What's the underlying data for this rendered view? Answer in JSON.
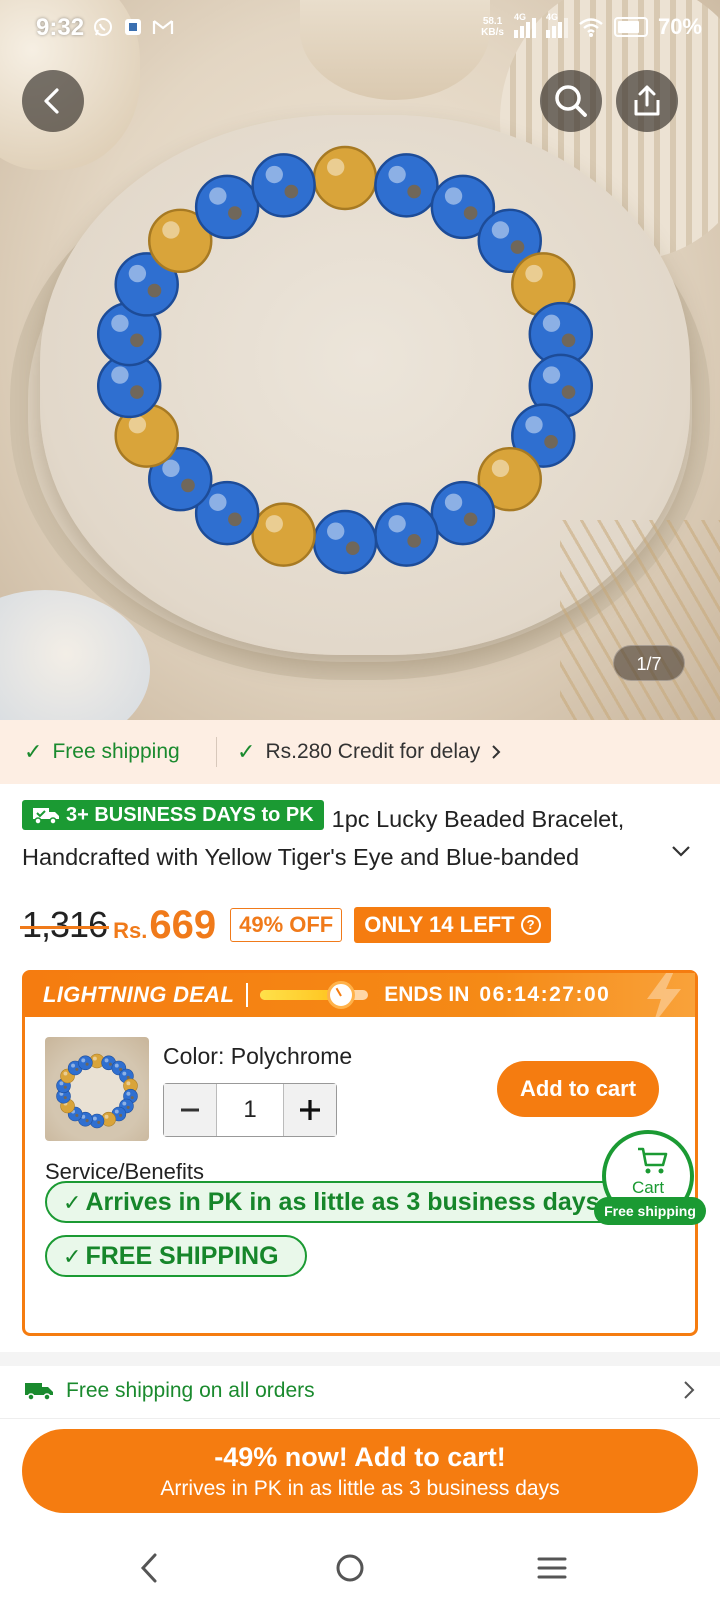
{
  "status_bar": {
    "time": "9:32",
    "notification_icons": [
      "whatsapp-icon",
      "app-icon",
      "gmail-icon"
    ],
    "net_speed_value": "58.1",
    "net_speed_unit": "KB/s",
    "signal1_label": "4G",
    "signal2_label": "4G",
    "battery": "70%"
  },
  "hero": {
    "image_counter": "1/7",
    "icons": {
      "back": "back-arrow-icon",
      "search": "search-icon",
      "share": "share-icon"
    }
  },
  "shipping_strip": {
    "free_shipping": "Free shipping",
    "credit": "Rs.280 Credit for delay"
  },
  "product": {
    "badge": "3+ BUSINESS DAYS to PK",
    "title": "1pc Lucky Beaded Bracelet, Handcrafted with Yellow Tiger's Eye and Blue-banded"
  },
  "price": {
    "old": "1,316",
    "currency": "Rs.",
    "current": "669",
    "discount": "49% OFF",
    "stock": "ONLY 14 LEFT"
  },
  "deal": {
    "label": "LIGHTNING DEAL",
    "progress": 0.72,
    "ends_label": "ENDS IN",
    "timer": "06:14:27:00",
    "color_label": "Color: Polychrome",
    "quantity": "1",
    "add_to_cart": "Add to cart",
    "service_title": "Service/Benefits",
    "benefit_1": "Arrives in PK in as little as 3 business days",
    "benefit_2": "FREE SHIPPING"
  },
  "floating_cart": {
    "label": "Cart",
    "badge": "Free shipping"
  },
  "free_shipping_row": {
    "text": "Free shipping on all orders"
  },
  "cta": {
    "line1": "-49% now! Add to cart!",
    "line2": "Arrives in PK in as little as 3 business days"
  },
  "colors": {
    "accent_orange": "#f57c10",
    "green": "#1b9a33",
    "bead_blue": "#2f6fd0",
    "bead_gold": "#d9a43a"
  }
}
